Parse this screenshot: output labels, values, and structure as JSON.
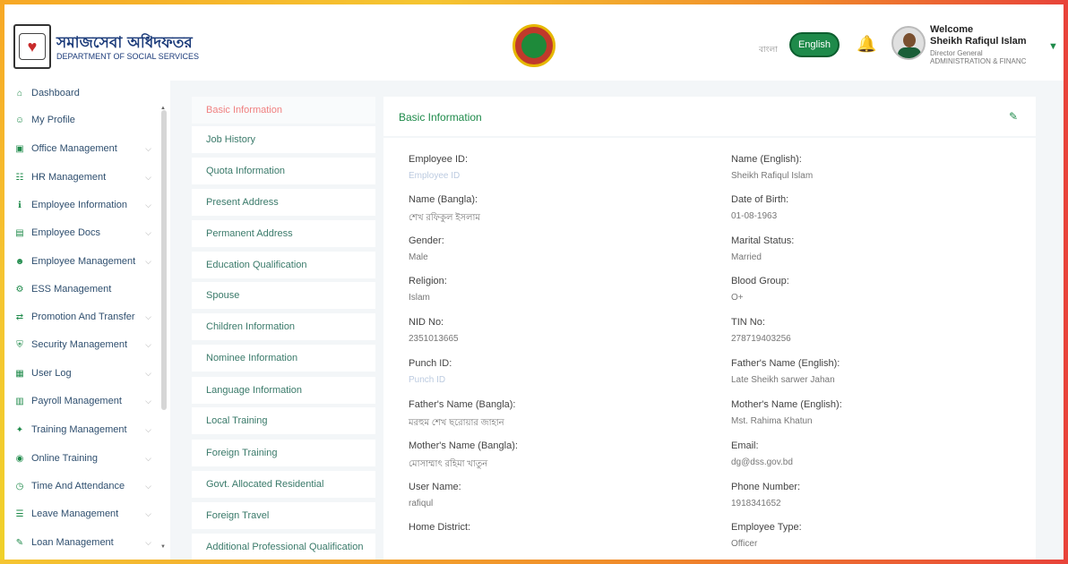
{
  "header": {
    "brand_bn": "সমাজসেবা অধিদফতর",
    "brand_en": "DEPARTMENT OF SOCIAL SERVICES",
    "lang_bn": "বাংলা",
    "lang_btn": "English",
    "welcome": "Welcome",
    "user_name": "Sheikh Rafiqul Islam",
    "user_role": "Director General",
    "user_dept": "ADMINISTRATION & FINANC"
  },
  "sidebar": {
    "items": [
      {
        "label": "Dashboard",
        "icon": "home-icon",
        "chevron": false
      },
      {
        "label": "My Profile",
        "icon": "user-icon",
        "chevron": false
      },
      {
        "label": "Office Management",
        "icon": "office-icon",
        "chevron": true
      },
      {
        "label": "HR Management",
        "icon": "hr-icon",
        "chevron": true
      },
      {
        "label": "Employee Information",
        "icon": "info-icon",
        "chevron": true
      },
      {
        "label": "Employee Docs",
        "icon": "docs-icon",
        "chevron": true
      },
      {
        "label": "Employee Management",
        "icon": "users-icon",
        "chevron": true
      },
      {
        "label": "ESS Management",
        "icon": "gear-icon",
        "chevron": false
      },
      {
        "label": "Promotion And Transfer",
        "icon": "transfer-icon",
        "chevron": true
      },
      {
        "label": "Security Management",
        "icon": "shield-icon",
        "chevron": true
      },
      {
        "label": "User Log",
        "icon": "log-icon",
        "chevron": true
      },
      {
        "label": "Payroll Management",
        "icon": "payroll-icon",
        "chevron": true
      },
      {
        "label": "Training Management",
        "icon": "training-icon",
        "chevron": true
      },
      {
        "label": "Online Training",
        "icon": "online-icon",
        "chevron": true
      },
      {
        "label": "Time And Attendance",
        "icon": "clock-icon",
        "chevron": true
      },
      {
        "label": "Leave Management",
        "icon": "leave-icon",
        "chevron": true
      },
      {
        "label": "Loan Management",
        "icon": "loan-icon",
        "chevron": true
      }
    ]
  },
  "tabs": [
    "Basic Information",
    "Job History",
    "Quota Information",
    "Present Address",
    "Permanent Address",
    "Education Qualification",
    "Spouse",
    "Children Information",
    "Nominee Information",
    "Language Information",
    "Local Training",
    "Foreign Training",
    "Govt. Allocated Residential",
    "Foreign Travel",
    "Additional Professional Qualification"
  ],
  "card": {
    "title": "Basic Information",
    "fields": [
      {
        "label": "Employee ID:",
        "value": "Employee ID",
        "placeholder": true
      },
      {
        "label": "Name (English):",
        "value": "Sheikh Rafiqul Islam",
        "placeholder": false
      },
      {
        "label": "Name (Bangla):",
        "value": "শেখ রফিকুল ইসলাম",
        "placeholder": false
      },
      {
        "label": "Date of Birth:",
        "value": "01-08-1963",
        "placeholder": false
      },
      {
        "label": "Gender:",
        "value": "Male",
        "placeholder": false
      },
      {
        "label": "Marital Status:",
        "value": "Married",
        "placeholder": false
      },
      {
        "label": "Religion:",
        "value": "Islam",
        "placeholder": false
      },
      {
        "label": "Blood Group:",
        "value": "O+",
        "placeholder": false
      },
      {
        "label": "NID No:",
        "value": "2351013665",
        "placeholder": false
      },
      {
        "label": "TIN No:",
        "value": "278719403256",
        "placeholder": false
      },
      {
        "label": "Punch ID:",
        "value": "Punch ID",
        "placeholder": true
      },
      {
        "label": "Father's Name (English):",
        "value": "Late Sheikh sarwer Jahan",
        "placeholder": false
      },
      {
        "label": "Father's Name (Bangla):",
        "value": "মরহুম শেখ ছরোয়ার জাহান",
        "placeholder": false
      },
      {
        "label": "Mother's Name (English):",
        "value": "Mst. Rahima Khatun",
        "placeholder": false
      },
      {
        "label": "Mother's Name (Bangla):",
        "value": "মোসাম্মাৎ রহিমা খাতুন",
        "placeholder": false
      },
      {
        "label": "Email:",
        "value": "dg@dss.gov.bd",
        "placeholder": false
      },
      {
        "label": "User Name:",
        "value": "rafiqul",
        "placeholder": false
      },
      {
        "label": "Phone Number:",
        "value": "1918341652",
        "placeholder": false
      },
      {
        "label": "Home District:",
        "value": "",
        "placeholder": false
      },
      {
        "label": "Employee Type:",
        "value": "Officer",
        "placeholder": false
      }
    ]
  }
}
